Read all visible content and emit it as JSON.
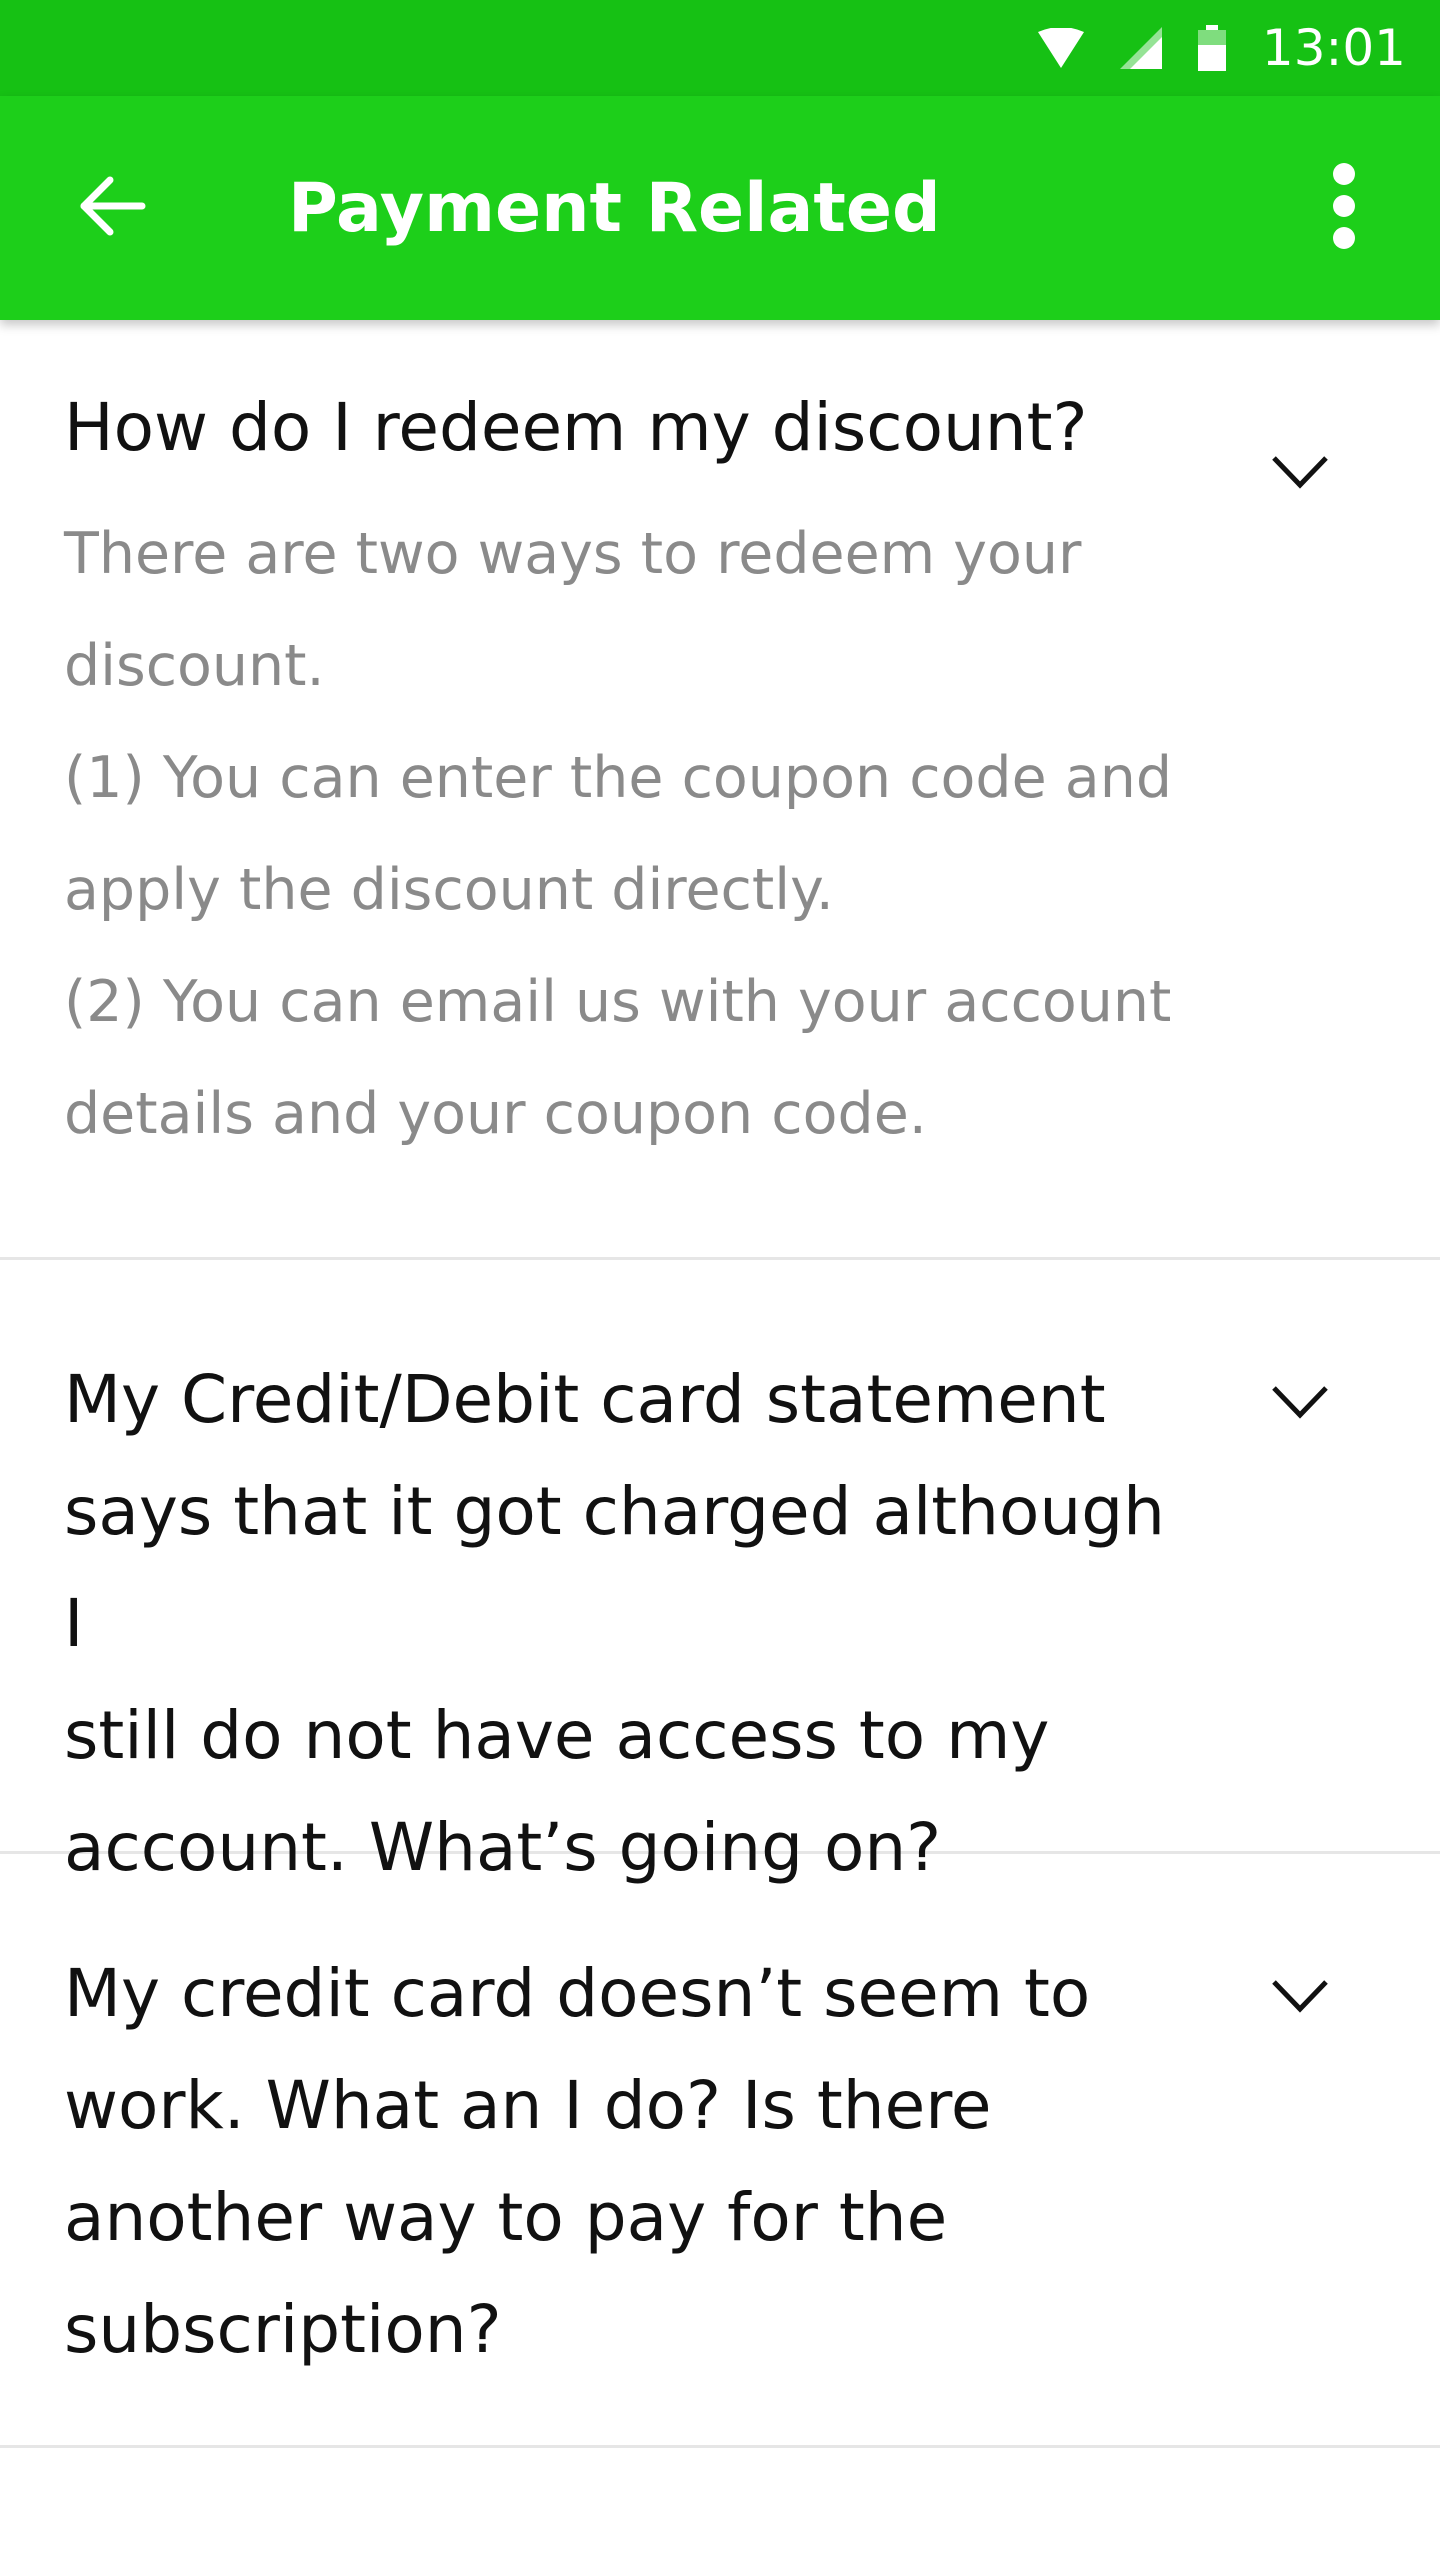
{
  "status_bar": {
    "time": "13:01",
    "icons": [
      "wifi-icon",
      "cell-signal-icon",
      "battery-icon"
    ],
    "color": "#16c114"
  },
  "app_bar": {
    "title": "Payment Related",
    "back_icon": "arrow-left-icon",
    "menu_icon": "more-vert-icon",
    "color": "#1dcf1a"
  },
  "faq": {
    "items": [
      {
        "question": "How do I redeem my discount?",
        "expanded": true,
        "answer_lines": [
          "There are two ways to redeem your",
          "discount.",
          "(1) You can enter the coupon code and",
          "apply the discount directly.",
          "(2) You can email us with your account",
          "details and your coupon code."
        ]
      },
      {
        "question_lines": [
          "My Credit/Debit card statement",
          "says that it got charged although I",
          "still do not have access to my",
          "account. What’s going on?"
        ],
        "expanded": false
      },
      {
        "question_lines": [
          "My credit card doesn’t seem to",
          "work. What an I do? Is there",
          "another way to pay for the",
          "subscription?"
        ],
        "expanded": false
      }
    ]
  }
}
